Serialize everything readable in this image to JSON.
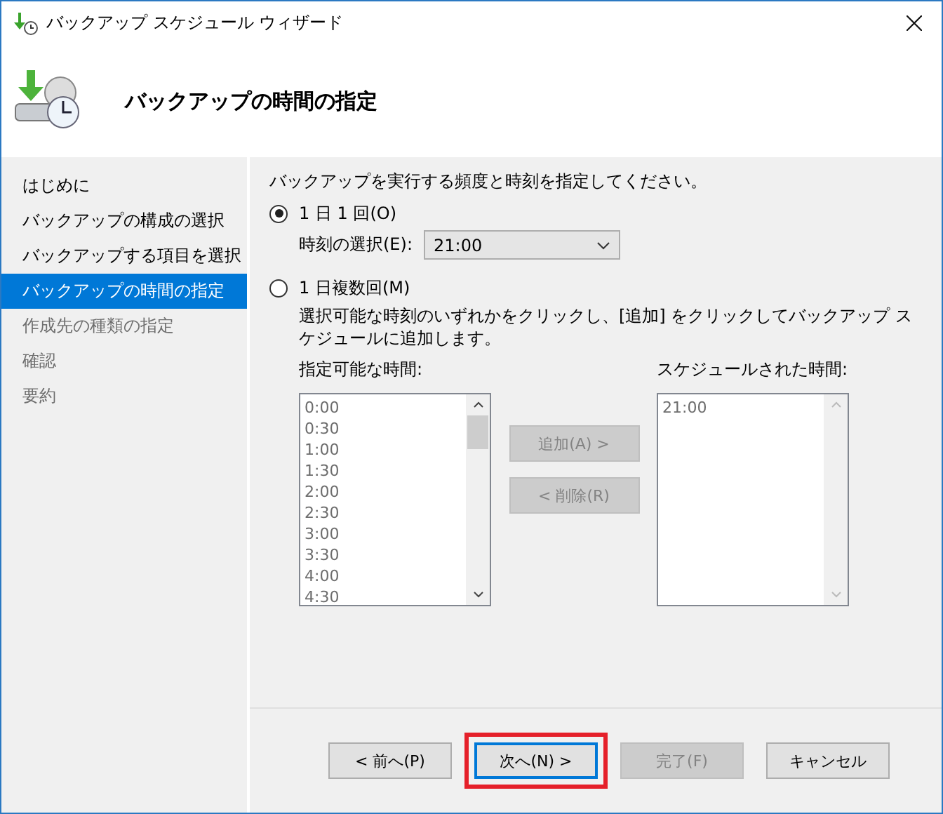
{
  "window": {
    "title": "バックアップ スケジュール ウィザード"
  },
  "header": {
    "title": "バックアップの時間の指定"
  },
  "sidebar": {
    "items": [
      {
        "label": "はじめに",
        "selected": false,
        "disabled": false
      },
      {
        "label": "バックアップの構成の選択",
        "selected": false,
        "disabled": false
      },
      {
        "label": "バックアップする項目を選択",
        "selected": false,
        "disabled": false
      },
      {
        "label": "バックアップの時間の指定",
        "selected": true,
        "disabled": false
      },
      {
        "label": "作成先の種類の指定",
        "selected": false,
        "disabled": true
      },
      {
        "label": "確認",
        "selected": false,
        "disabled": true
      },
      {
        "label": "要約",
        "selected": false,
        "disabled": true
      }
    ]
  },
  "content": {
    "instruction": "バックアップを実行する頻度と時刻を指定してください。",
    "options": [
      {
        "kind": "once",
        "label": "1 日 1 回(O)",
        "selected": true,
        "time_label": "時刻の選択(E):",
        "time_value": "21:00"
      },
      {
        "kind": "multiple",
        "label": "1 日複数回(M)",
        "selected": false,
        "description": "選択可能な時刻のいずれかをクリックし、[追加] をクリックしてバックアップ スケジュールに追加します。"
      }
    ],
    "available": {
      "label": "指定可能な時間:",
      "items": [
        "0:00",
        "0:30",
        "1:00",
        "1:30",
        "2:00",
        "2:30",
        "3:00",
        "3:30",
        "4:00",
        "4:30"
      ]
    },
    "scheduled": {
      "label": "スケジュールされた時間:",
      "items": [
        "21:00"
      ]
    },
    "add_button": {
      "label": "追加(A) >",
      "disabled": true
    },
    "remove_button": {
      "label": "< 削除(R)",
      "disabled": true
    }
  },
  "buttons": [
    {
      "label": "< 前へ(P)",
      "disabled": false,
      "highlighted": false
    },
    {
      "label": "次へ(N) >",
      "disabled": false,
      "highlighted": true
    },
    {
      "label": "完了(F)",
      "disabled": true,
      "highlighted": false
    },
    {
      "label": "キャンセル",
      "disabled": false,
      "highlighted": false
    }
  ]
}
